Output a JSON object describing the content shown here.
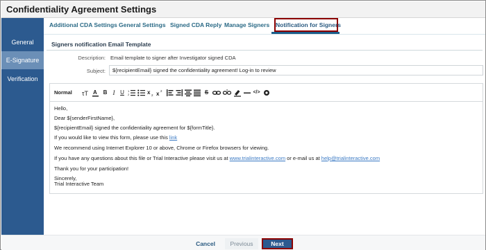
{
  "window": {
    "title": "Confidentiality Agreement Settings"
  },
  "sidebar": {
    "items": [
      {
        "label": "General",
        "active": false
      },
      {
        "label": "E-Signature",
        "active": true
      },
      {
        "label": "Verification",
        "active": false
      }
    ]
  },
  "tabs": [
    {
      "label": "Additional CDA Settings",
      "active": false
    },
    {
      "label": "General Settings",
      "active": false
    },
    {
      "label": "Signed CDA Reply",
      "active": false
    },
    {
      "label": "Manage Signers",
      "active": false
    },
    {
      "label": "Notification for Signers",
      "active": true
    }
  ],
  "section": {
    "title": "Signers notification Email Template",
    "description_label": "Description:",
    "description_value": "Email template to signer after Investigator signed CDA",
    "subject_label": "Subject:",
    "subject_value": "${recipientEmail} signed the confidentiality agreement! Log-in to review"
  },
  "toolbar": {
    "format_label": "Normal",
    "buttons": [
      "font-size-icon",
      "text-color-icon",
      "bold-icon",
      "italic-icon",
      "underline-icon",
      "ordered-list-icon",
      "bullet-list-icon",
      "subscript-icon",
      "superscript-icon",
      "align-left-icon",
      "align-right-icon",
      "align-center-icon",
      "align-justify-icon",
      "strikethrough-icon",
      "link-icon",
      "unlink-icon",
      "highlight-icon",
      "horizontal-rule-icon",
      "code-icon",
      "settings-icon"
    ]
  },
  "editor": {
    "greeting": "Hello,",
    "dear": "Dear ${senderFirstName},",
    "signed": "${recipientEmail} signed the confidentiality agreement for ${formTitle}.",
    "view_prefix": "If you would like to view this form, please use this ",
    "view_link": "link",
    "browsers": "We recommend using Internet Explorer 10 or above, Chrome or Firefox browsers for viewing.",
    "questions_prefix": "If you have any questions about this file or Trial Interactive please visit us at ",
    "questions_site": "www.trialinteractive.com",
    "questions_mid": " or e-mail us at ",
    "questions_email": "help@trialinteractive.com",
    "thanks": "Thank you for your participation!",
    "closing": "Sincerely,",
    "team": "Trial Interactive Team"
  },
  "footer": {
    "cancel_label": "Cancel",
    "previous_label": "Previous",
    "next_label": "Next"
  },
  "colors": {
    "sidebar": "#2c5a8f",
    "sidebar_active": "#6b8fb7",
    "highlight_border": "#8b0000",
    "link": "#3b7ac4"
  }
}
